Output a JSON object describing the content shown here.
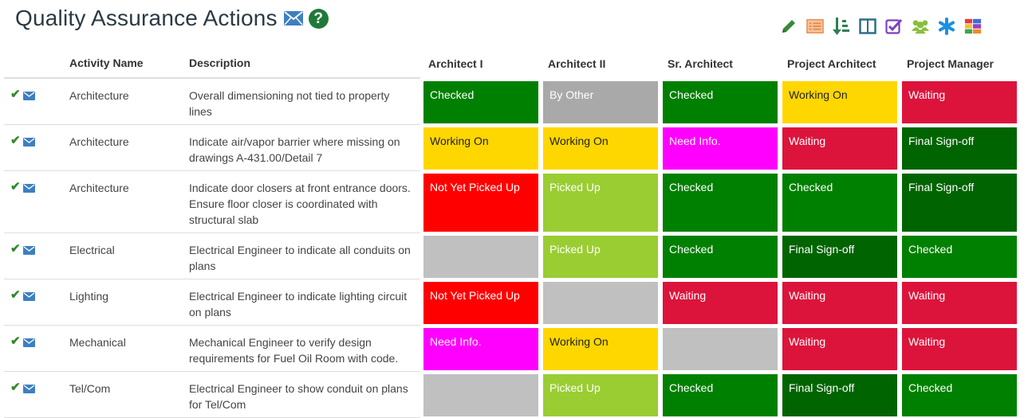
{
  "header": {
    "title": "Quality Assurance Actions",
    "help_glyph": "?"
  },
  "icons": {
    "title_mail": "envelope-icon",
    "help": "question-circle-icon",
    "toolbar": [
      "pencil-icon",
      "list-icon",
      "sort-icon",
      "columns-icon",
      "checkbox-icon",
      "users-icon",
      "asterisk-icon",
      "color-grid-icon"
    ],
    "row_check": "checkmark-icon",
    "row_mail": "envelope-icon"
  },
  "colors": {
    "Checked": "#008000",
    "By Other": "#a9a9a9",
    "Working On": "#ffd700",
    "Waiting": "#dc143c",
    "Need Info.": "#ff00ff",
    "Final Sign-off": "#006400",
    "Not Yet Picked Up": "#ff0000",
    "Picked Up": "#9acd32",
    "": "#c0c0c0"
  },
  "check_glyph": "✔",
  "table": {
    "headers": [
      "",
      "Activity Name",
      "Description",
      "Architect I",
      "Architect II",
      "Sr. Architect",
      "Project Architect",
      "Project Manager"
    ],
    "rows": [
      {
        "activity": "Architecture",
        "description": "Overall dimensioning not tied to property lines",
        "statuses": [
          "Checked",
          "By Other",
          "Checked",
          "Working On",
          "Waiting"
        ]
      },
      {
        "activity": "Architecture",
        "description": "Indicate air/vapor barrier where missing on drawings A-431.00/Detail 7",
        "statuses": [
          "Working On",
          "Working On",
          "Need Info.",
          "Waiting",
          "Final Sign-off"
        ]
      },
      {
        "activity": "Architecture",
        "description": "Indicate door closers at front entrance doors. Ensure floor closer is coordinated with structural slab",
        "statuses": [
          "Not Yet Picked Up",
          "Picked Up",
          "Checked",
          "Checked",
          "Final Sign-off"
        ]
      },
      {
        "activity": "Electrical",
        "description": "Electrical Engineer to indicate all conduits on plans",
        "statuses": [
          "",
          "Picked Up",
          "Checked",
          "Final Sign-off",
          "Checked"
        ]
      },
      {
        "activity": "Lighting",
        "description": "Electrical Engineer to indicate lighting circuit on plans",
        "statuses": [
          "Not Yet Picked Up",
          "",
          "Waiting",
          "Waiting",
          "Waiting"
        ]
      },
      {
        "activity": "Mechanical",
        "description": "Mechanical Engineer to verify design requirements for Fuel Oil Room with code.",
        "statuses": [
          "Need Info.",
          "Working On",
          "",
          "Waiting",
          "Waiting"
        ]
      },
      {
        "activity": "Tel/Com",
        "description": "Electrical Engineer to show conduit on plans for Tel/Com",
        "statuses": [
          "",
          "Picked Up",
          "Checked",
          "Final Sign-off",
          "Checked"
        ]
      }
    ]
  }
}
